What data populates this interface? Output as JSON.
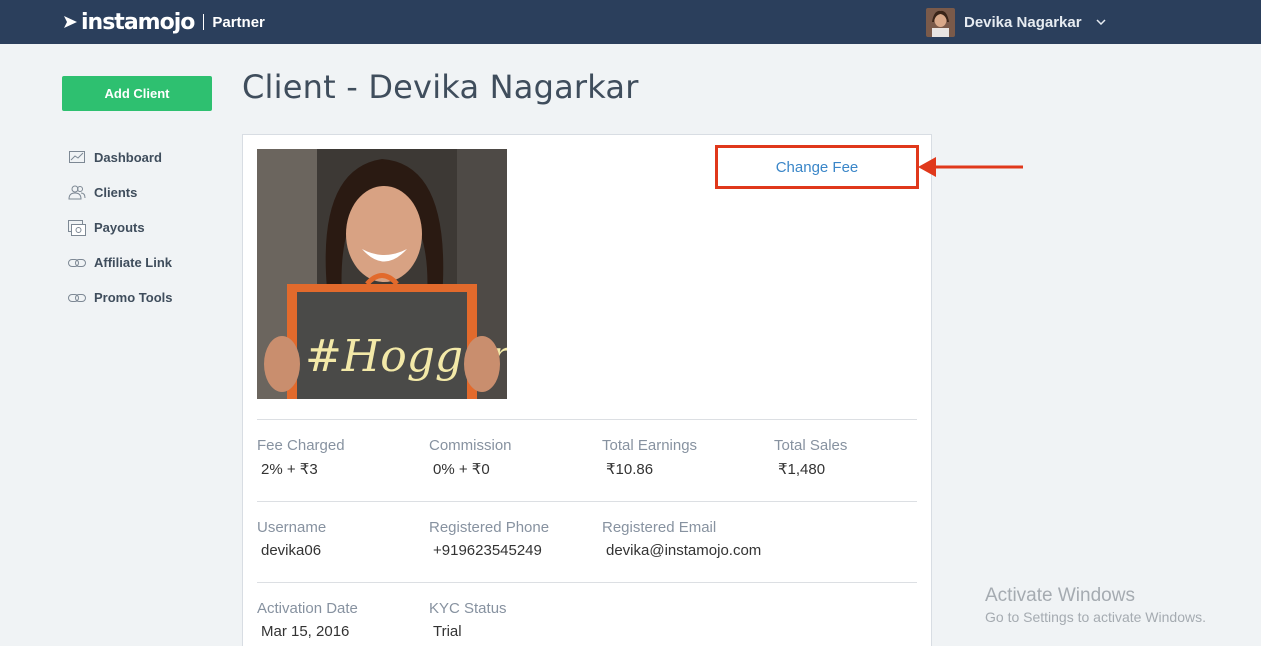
{
  "header": {
    "logo_text": "instamojo",
    "logo_sub": "Partner",
    "user_name": "Devika Nagarkar"
  },
  "sidebar": {
    "add_client_label": "Add Client",
    "items": [
      {
        "label": "Dashboard",
        "icon": "chart-icon"
      },
      {
        "label": "Clients",
        "icon": "users-icon"
      },
      {
        "label": "Payouts",
        "icon": "payout-icon"
      },
      {
        "label": "Affiliate Link",
        "icon": "link-icon"
      },
      {
        "label": "Promo Tools",
        "icon": "link-icon"
      }
    ]
  },
  "main": {
    "title": "Client - Devika Nagarkar",
    "change_fee_label": "Change Fee",
    "photo_text": "#Hogger",
    "stats": [
      {
        "label": "Fee Charged",
        "value": "2% + ₹3"
      },
      {
        "label": "Commission",
        "value": "0% + ₹0"
      },
      {
        "label": "Total Earnings",
        "value": "₹10.86"
      },
      {
        "label": "Total Sales",
        "value": "₹1,480"
      }
    ],
    "contact": [
      {
        "label": "Username",
        "value": "devika06"
      },
      {
        "label": "Registered Phone",
        "value": "+919623545249"
      },
      {
        "label": "Registered Email",
        "value": "devika@instamojo.com"
      }
    ],
    "status": [
      {
        "label": "Activation Date",
        "value": "Mar 15, 2016"
      },
      {
        "label": "KYC Status",
        "value": "Trial"
      }
    ]
  },
  "watermark": {
    "title": "Activate Windows",
    "subtitle": "Go to Settings to activate Windows."
  },
  "colors": {
    "topbar": "#2b3f5c",
    "add_button": "#2ec070",
    "link": "#3a86c8",
    "highlight": "#e0381b"
  }
}
